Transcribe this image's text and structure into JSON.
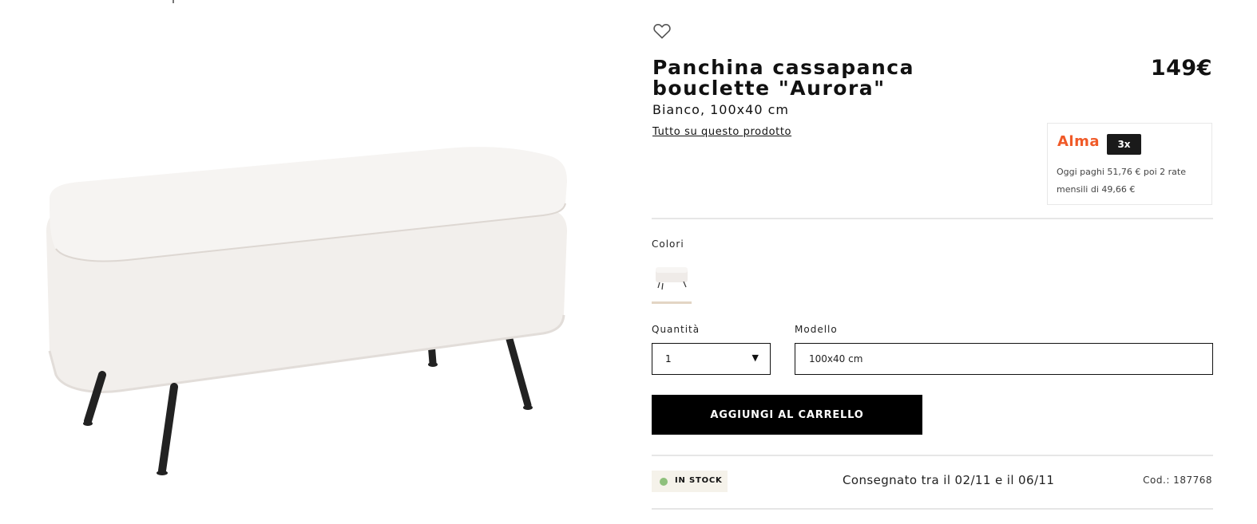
{
  "product": {
    "title": "Panchina cassapanca bouclette \"Aurora\"",
    "subtitle": "Bianco, 100x40 cm",
    "details_link": "Tutto su questo prodotto",
    "price": "149€",
    "image_alt": "product-bench-image"
  },
  "alma": {
    "logo": "Alma",
    "badge": "3x",
    "text": "Oggi paghi 51,76 € poi 2 rate mensili di 49,66 €"
  },
  "options": {
    "colors_label": "Colori",
    "quantity_label": "Quantità",
    "quantity_value": "1",
    "model_label": "Modello",
    "model_value": "100x40 cm"
  },
  "cart": {
    "add_label": "AGGIUNGI AL CARRELLO"
  },
  "shipping": {
    "stock_label": "IN STOCK",
    "delivery_text": "Consegnato tra il 02/11 e il 06/11",
    "code": "Cod.: 187768"
  },
  "colors": {
    "alma_orange": "#f05a28",
    "stock_green": "#8ec07c",
    "swatch_underline": "#e3d5c4"
  }
}
